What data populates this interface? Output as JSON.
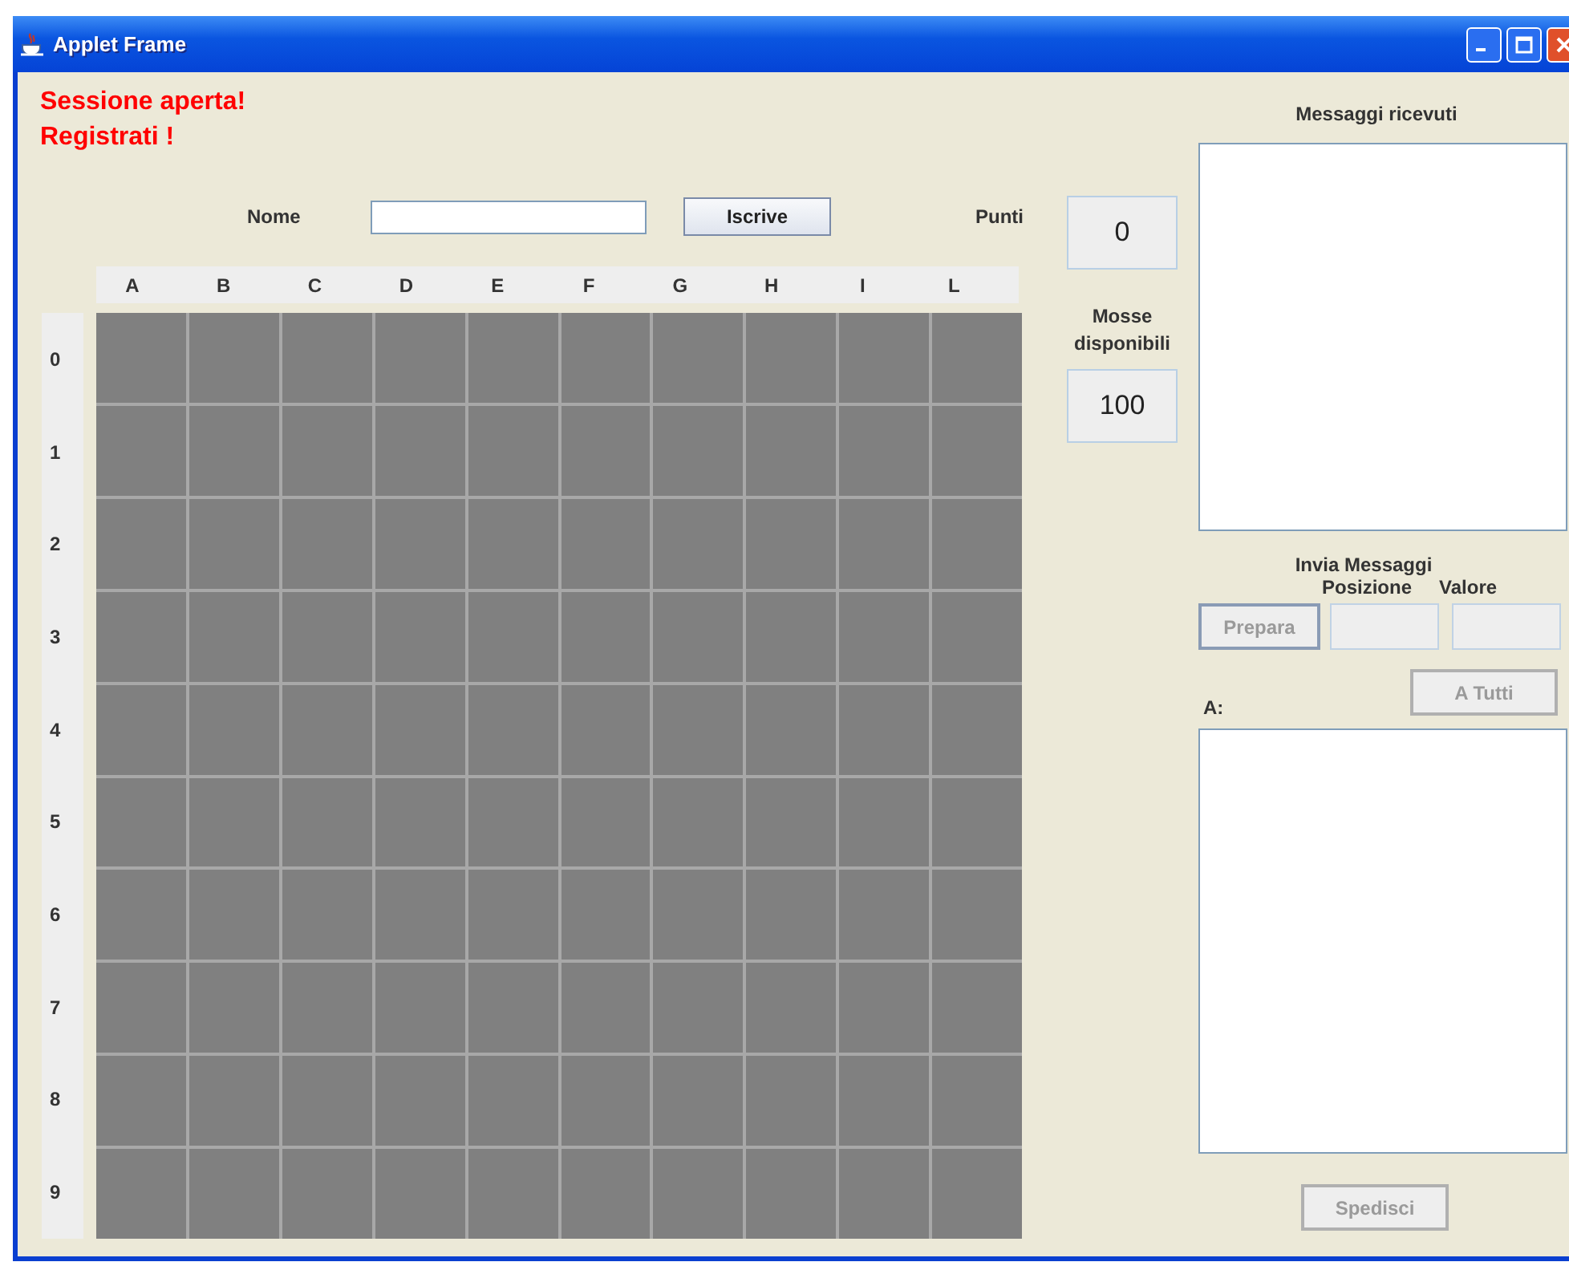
{
  "window": {
    "title": "Applet Frame"
  },
  "status_messages": [
    "Sessione aperta!",
    "Registrati !"
  ],
  "registration": {
    "name_label": "Nome",
    "button": {
      "label": "Iscrive",
      "disabled": false
    }
  },
  "score": {
    "label": "Punti",
    "value": "0"
  },
  "moves": {
    "label": "Mosse disponibili",
    "value": "100"
  },
  "board": {
    "columns": [
      "A",
      "B",
      "C",
      "D",
      "E",
      "F",
      "G",
      "H",
      "I",
      "L"
    ],
    "rows": [
      "0",
      "1",
      "2",
      "3",
      "4",
      "5",
      "6",
      "7",
      "8",
      "9"
    ]
  },
  "received": {
    "label": "Messaggi ricevuti"
  },
  "send": {
    "title": "Invia Messaggi",
    "position_label": "Posizione",
    "value_label": "Valore",
    "prepare_button": {
      "label": "Prepara",
      "disabled": true
    },
    "all_button": {
      "label": "A Tutti",
      "disabled": true
    },
    "recipient_label": "A:",
    "send_button": {
      "label": "Spedisci",
      "disabled": true
    }
  }
}
